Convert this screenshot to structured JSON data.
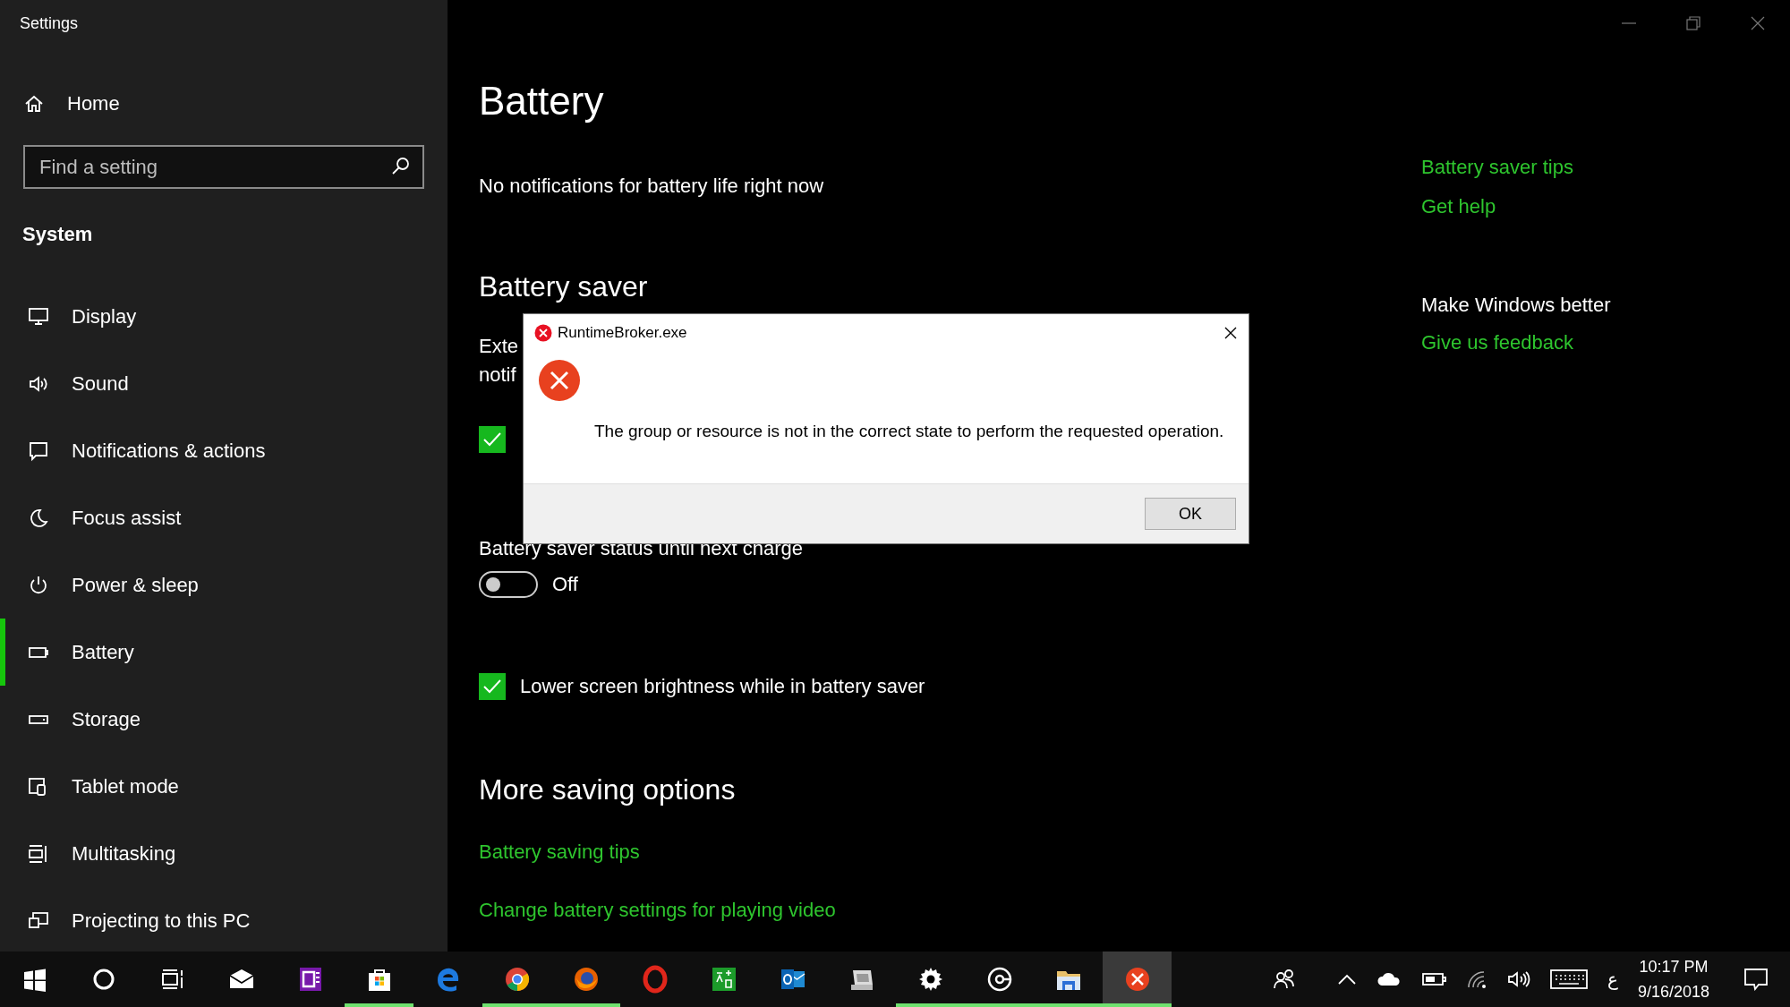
{
  "window": {
    "title": "Settings"
  },
  "sidebar": {
    "home": "Home",
    "search": {
      "placeholder": "Find a setting"
    },
    "section": "System",
    "items": [
      {
        "label": "Display",
        "kind": "display",
        "selected": false
      },
      {
        "label": "Sound",
        "kind": "sound",
        "selected": false
      },
      {
        "label": "Notifications & actions",
        "kind": "notifications",
        "selected": false
      },
      {
        "label": "Focus assist",
        "kind": "focus",
        "selected": false
      },
      {
        "label": "Power & sleep",
        "kind": "power",
        "selected": false
      },
      {
        "label": "Battery",
        "kind": "battery",
        "selected": true
      },
      {
        "label": "Storage",
        "kind": "storage",
        "selected": false
      },
      {
        "label": "Tablet mode",
        "kind": "tablet",
        "selected": false
      },
      {
        "label": "Multitasking",
        "kind": "multitasking",
        "selected": false
      },
      {
        "label": "Projecting to this PC",
        "kind": "projecting",
        "selected": false
      }
    ]
  },
  "page": {
    "title": "Battery",
    "notice": "No notifications for battery life right now",
    "saver_heading": "Battery saver",
    "covered_lines": [
      "Exte",
      "notif"
    ],
    "covered_checkbox": {
      "checked": true
    },
    "status_label": "Battery saver status until next charge",
    "toggle": {
      "on": false,
      "label": "Off"
    },
    "brightness": {
      "checked": true,
      "label": "Lower screen brightness while in battery saver"
    },
    "more_heading": "More saving options",
    "links": [
      "Battery saving tips",
      "Change battery settings for playing video"
    ]
  },
  "related": {
    "links": [
      "Battery saver tips",
      "Get help"
    ],
    "heading": "Make Windows better",
    "feedback": "Give us feedback"
  },
  "dialog": {
    "title": "RuntimeBroker.exe",
    "message": "The group or resource is not in the correct state to perform the requested operation.",
    "buttons": [
      "OK"
    ]
  },
  "taskbar": {
    "apps": [
      {
        "kind": "start",
        "running": false,
        "active": false
      },
      {
        "kind": "cortana",
        "running": false,
        "active": false
      },
      {
        "kind": "taskview",
        "running": false,
        "active": false
      },
      {
        "kind": "mail",
        "running": false,
        "active": false
      },
      {
        "kind": "onenote",
        "running": false,
        "active": false
      },
      {
        "kind": "store",
        "running": true,
        "active": false
      },
      {
        "kind": "edge",
        "running": false,
        "active": false
      },
      {
        "kind": "chrome",
        "running": true,
        "active": false
      },
      {
        "kind": "firefox",
        "running": true,
        "active": false
      },
      {
        "kind": "opera",
        "running": false,
        "active": false
      },
      {
        "kind": "translator",
        "running": false,
        "active": false
      },
      {
        "kind": "outlook",
        "running": false,
        "active": false
      },
      {
        "kind": "computer",
        "running": false,
        "active": false
      },
      {
        "kind": "settings",
        "running": true,
        "active": false
      },
      {
        "kind": "groove",
        "running": true,
        "active": false
      },
      {
        "kind": "explorer",
        "running": true,
        "active": false
      },
      {
        "kind": "error",
        "running": true,
        "active": true
      }
    ],
    "tray": {
      "language": "ع",
      "time": "10:17 PM",
      "date": "9/16/2018"
    }
  }
}
